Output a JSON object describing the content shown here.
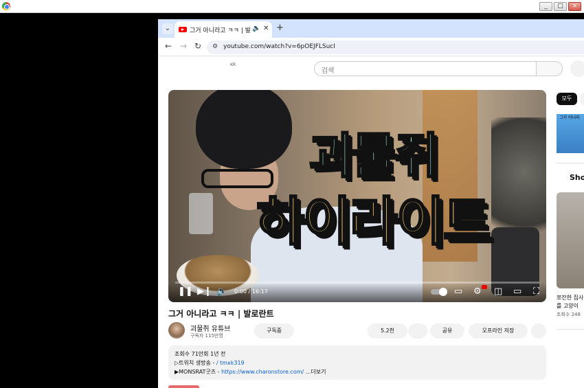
{
  "window": {
    "controls": [
      "_",
      "□",
      "×"
    ]
  },
  "browser": {
    "tab_title": "그거 아니라고 ㅋㅋ | 발로란트 - YouTube",
    "new_tab": "+",
    "url": "youtube.com/watch?v=6pOEJFLSucI"
  },
  "youtube": {
    "region": "KR",
    "search_placeholder": "검색"
  },
  "thumbnail": {
    "line1": "괴물쥐",
    "line2": "하이라이트"
  },
  "player": {
    "time": "0:00 / 16:17",
    "progress": 0.0
  },
  "video": {
    "title": "그거 아니라고 ㅋㅋ | 발로란트",
    "channel": "괴물쥐 유튜브",
    "subscribers": "구독자 115만명",
    "subscribed_label": "구독중",
    "likes": "5.2천",
    "share_label": "공유",
    "offline_label": "오프라인 저장"
  },
  "description": {
    "stats": "조회수 71만회  1년 전",
    "line1_prefix": "▷트위치 생방송 - ",
    "line1_link": "/ tmxk319",
    "line2_prefix": "▶MONSRAT굿즈 - ",
    "line2_link": "https://www.charonstore.com/",
    "more": "...더보기"
  },
  "sidebar": {
    "chip_all": "모두",
    "playlist_label": "그거 아니라",
    "shorts_label": "Sho",
    "short_title_1": "쪼잔한 집사",
    "short_title_2": "를 고양이 ",
    "short_views": "조회수 248"
  }
}
